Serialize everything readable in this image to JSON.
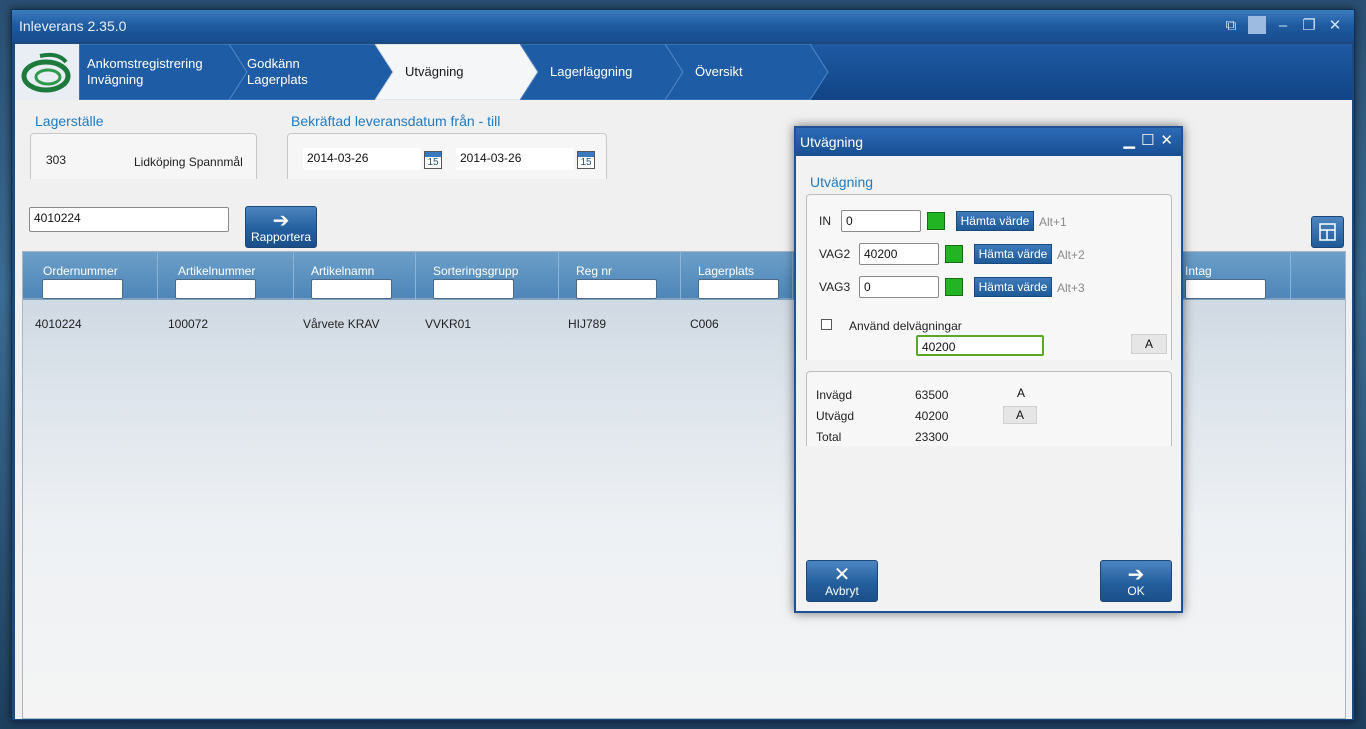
{
  "window": {
    "title": "Inleverans 2.35.0"
  },
  "nav": {
    "steps": [
      {
        "label": "Ankomstregistrering\nInvägning"
      },
      {
        "label": "Godkänn\nLagerplats"
      },
      {
        "label": "Utvägning"
      },
      {
        "label": "Lagerläggning"
      },
      {
        "label": "Översikt"
      }
    ]
  },
  "lagerstalle": {
    "title": "Lagerställe",
    "code": "303",
    "name": "Lidköping Spannmål"
  },
  "dates": {
    "title": "Bekräftad leveransdatum från - till",
    "from": "2014-03-26",
    "to": "2014-03-26",
    "cal_label": "15"
  },
  "search": {
    "value": "4010224"
  },
  "report_button": {
    "label": "Rapportera"
  },
  "grid": {
    "columns": [
      "Ordernummer",
      "Artikelnummer",
      "Artikelnamn",
      "Sorteringsgrupp",
      "Reg nr",
      "Lagerplats",
      "Intag"
    ],
    "row": [
      "4010224",
      "100072",
      "Vårvete KRAV",
      "VVKR01",
      "HIJ789",
      "C006"
    ]
  },
  "dialog": {
    "title": "Utvägning",
    "section": "Utvägning",
    "rows": [
      {
        "label": "IN",
        "value": "0",
        "button": "Hämta värde",
        "shortcut": "Alt+1"
      },
      {
        "label": "VAG2",
        "value": "40200",
        "button": "Hämta värde",
        "shortcut": "Alt+2"
      },
      {
        "label": "VAG3",
        "value": "0",
        "button": "Hämta värde",
        "shortcut": "Alt+3"
      }
    ],
    "use_partial": {
      "label": "Använd delvägningar",
      "checked": false
    },
    "partial_value": "40200",
    "a_label": "A",
    "summary": [
      {
        "label": "Invägd",
        "value": "63500",
        "a": "A"
      },
      {
        "label": "Utvägd",
        "value": "40200",
        "a": "A"
      },
      {
        "label": "Total",
        "value": "23300"
      }
    ],
    "cancel": "Avbryt",
    "ok": "OK"
  },
  "colors": {
    "accent": "#1f7ac0",
    "nav_bg": "#114486",
    "green": "#22b422"
  }
}
